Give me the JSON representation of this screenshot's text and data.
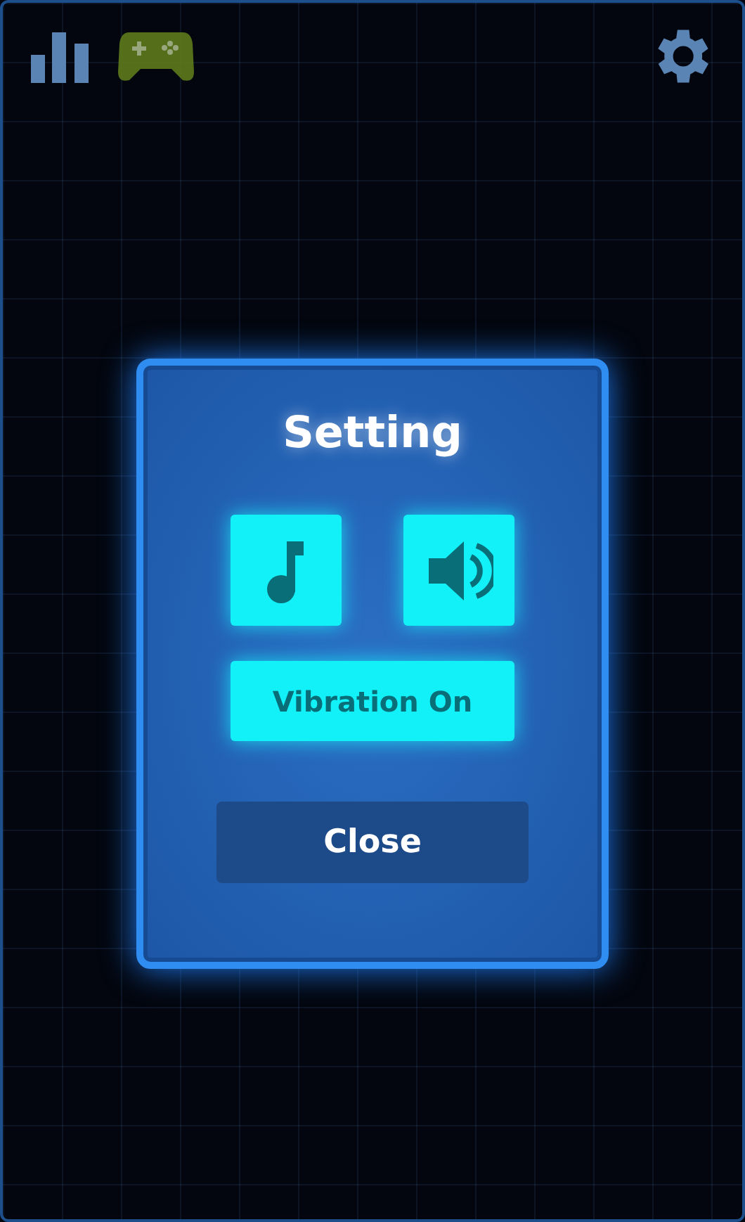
{
  "dialog": {
    "title": "Setting",
    "toggles": [
      {
        "kind": "music",
        "on": true
      },
      {
        "kind": "sound",
        "on": true
      }
    ],
    "vibration": {
      "label": "Vibration On",
      "on": true
    },
    "close": "Close"
  }
}
